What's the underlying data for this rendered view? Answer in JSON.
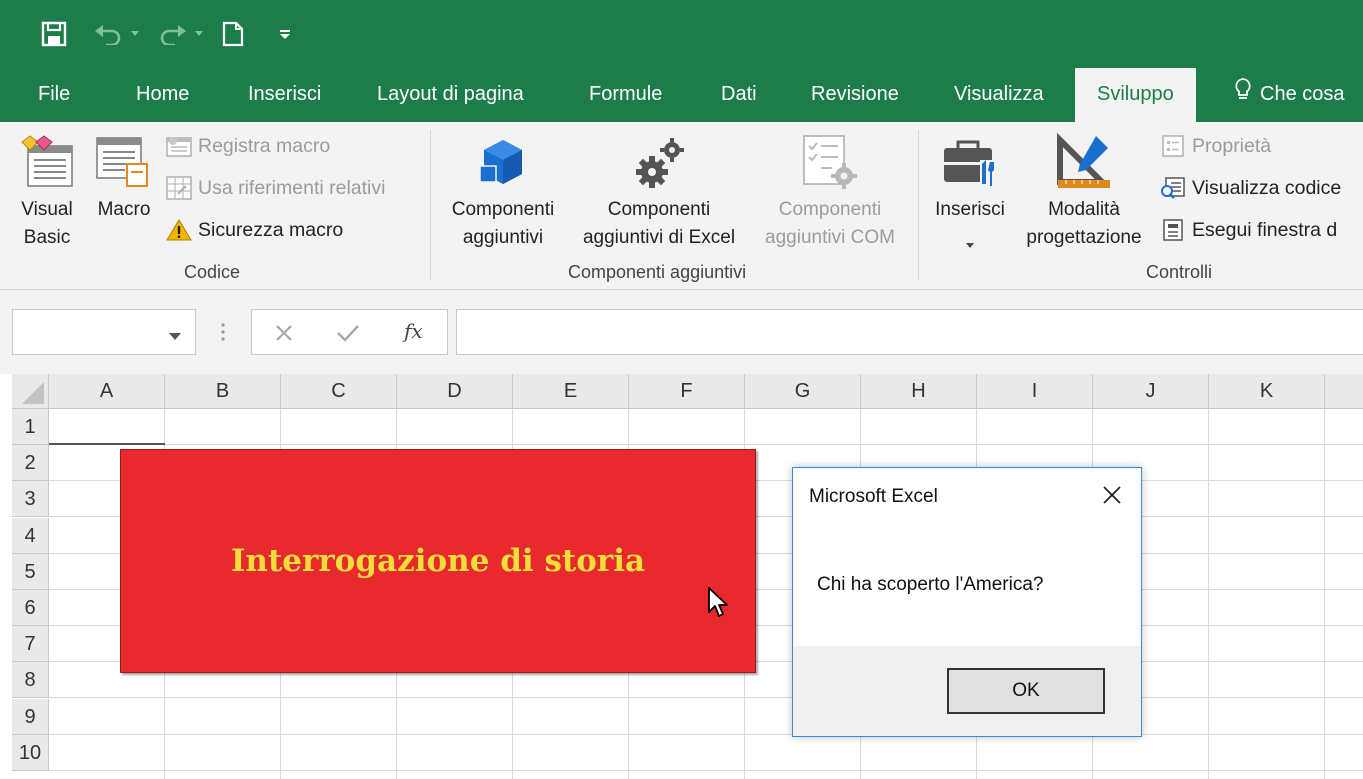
{
  "quick_access": [
    "save-icon",
    "undo-icon",
    "redo-icon",
    "new-file-icon",
    "customize-icon"
  ],
  "tabs": [
    {
      "label": "File"
    },
    {
      "label": "Home"
    },
    {
      "label": "Inserisci"
    },
    {
      "label": "Layout di pagina"
    },
    {
      "label": "Formule"
    },
    {
      "label": "Dati"
    },
    {
      "label": "Revisione"
    },
    {
      "label": "Visualizza"
    },
    {
      "label": "Sviluppo",
      "active": true
    },
    {
      "label": "Che cosa"
    }
  ],
  "ribbon": {
    "codice": {
      "group_label": "Codice",
      "visual_basic": [
        "Visual",
        "Basic"
      ],
      "macro": "Macro",
      "registra_macro": "Registra macro",
      "usa_riferimenti": "Usa riferimenti relativi",
      "sicurezza_macro": "Sicurezza macro"
    },
    "componenti": {
      "group_label": "Componenti aggiuntivi",
      "componenti_aggiuntivi": [
        "Componenti",
        "aggiuntivi"
      ],
      "componenti_excel": [
        "Componenti",
        "aggiuntivi di Excel"
      ],
      "componenti_com": [
        "Componenti",
        "aggiuntivi COM"
      ]
    },
    "controlli": {
      "group_label": "Controlli",
      "inserisci": "Inserisci",
      "modalita": [
        "Modalità",
        "progettazione"
      ],
      "proprieta": "Proprietà",
      "visualizza_codice": "Visualizza codice",
      "esegui_finestra": "Esegui finestra d"
    }
  },
  "formula_bar": {
    "name_box": "",
    "formula": "",
    "fx_label": "fx"
  },
  "columns": [
    "A",
    "B",
    "C",
    "D",
    "E",
    "F",
    "G",
    "H",
    "I",
    "J",
    "K"
  ],
  "rows": [
    "1",
    "2",
    "3",
    "4",
    "5",
    "6",
    "7",
    "8",
    "9",
    "10"
  ],
  "shape": {
    "text": "Interrogazione di storia",
    "fill_color": "#e8292d",
    "text_color": "#f2de3a"
  },
  "dialog": {
    "title": "Microsoft Excel",
    "message": "Chi ha scoperto l'America?",
    "ok_label": "OK"
  },
  "colors": {
    "excel_green": "#1c7c4a",
    "ribbon_bg": "#f3f3f3"
  }
}
